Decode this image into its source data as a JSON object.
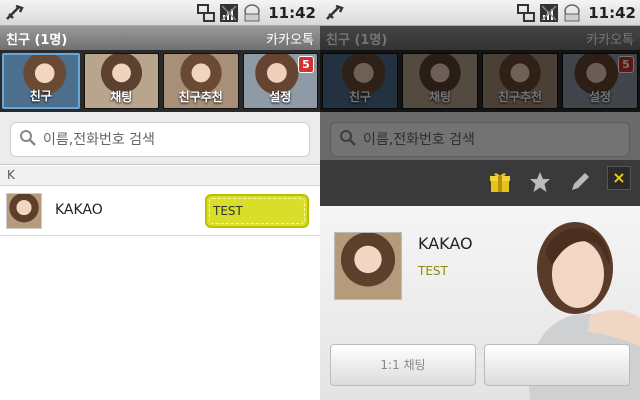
{
  "status_bar": {
    "time": "11:42"
  },
  "title_bar": {
    "title": "친구 (1명)",
    "app_name": "카카오톡"
  },
  "tabs": [
    {
      "label": "친구",
      "badge": ""
    },
    {
      "label": "채팅",
      "badge": ""
    },
    {
      "label": "친구추천",
      "badge": ""
    },
    {
      "label": "설정",
      "badge": "5"
    }
  ],
  "search": {
    "placeholder": "이름,전화번호 검색"
  },
  "friend_list": {
    "section": "K",
    "items": [
      {
        "name": "KAKAO",
        "status": "TEST"
      }
    ]
  },
  "profile_popup": {
    "name": "KAKAO",
    "status": "TEST",
    "chat_button": "1:1 채팅",
    "icons": [
      "gift-icon",
      "star-icon",
      "pencil-icon",
      "close-icon"
    ],
    "close_label": "×"
  },
  "colors": {
    "status_bubble": "#d8de2a",
    "badge": "#d43030",
    "accent": "#6aa6d8"
  }
}
